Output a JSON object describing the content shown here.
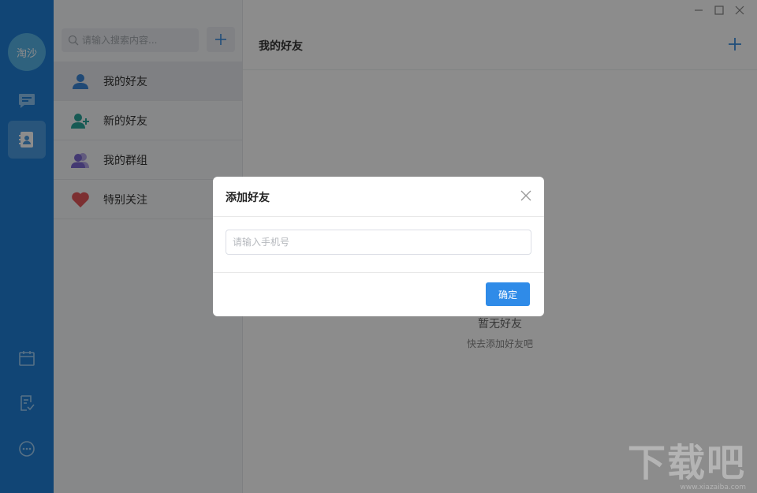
{
  "window": {
    "controls": [
      "minimize-icon",
      "maximize-icon",
      "close-icon"
    ]
  },
  "rail": {
    "avatar_text": "淘沙",
    "accent": "#1f7fd6",
    "items_top": [
      {
        "name": "chat-icon",
        "active": false
      },
      {
        "name": "contacts-icon",
        "active": true
      }
    ],
    "items_bottom": [
      {
        "name": "calendar-icon"
      },
      {
        "name": "task-icon"
      },
      {
        "name": "more-icon"
      }
    ]
  },
  "sidebar": {
    "search_placeholder": "请输入搜索内容...",
    "add_icon": "plus-icon",
    "items": [
      {
        "label": "我的好友",
        "icon": "person-icon",
        "active": true
      },
      {
        "label": "新的好友",
        "icon": "person-add-icon",
        "active": false
      },
      {
        "label": "我的群组",
        "icon": "group-icon",
        "active": false
      },
      {
        "label": "特别关注",
        "icon": "heart-icon",
        "active": false
      }
    ]
  },
  "main": {
    "title": "我的好友",
    "empty_title": "暂无好友",
    "empty_subtitle": "快去添加好友吧"
  },
  "dialog": {
    "title": "添加好友",
    "input_placeholder": "请输入手机号",
    "confirm_label": "确定",
    "button_color": "#2f8be8"
  },
  "watermark": {
    "text": "下载吧",
    "sub": "www.xiazaiba.com"
  }
}
